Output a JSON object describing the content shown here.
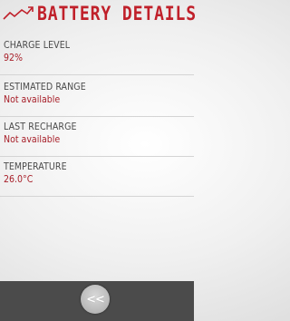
{
  "header": {
    "title": "BATTERY DETAILS",
    "logo_icon": "trend-line-icon",
    "accent_color": "#c0202a"
  },
  "details": [
    {
      "label": "CHARGE LEVEL",
      "value": "92%"
    },
    {
      "label": "ESTIMATED RANGE",
      "value": "Not available"
    },
    {
      "label": "LAST RECHARGE",
      "value": "Not available"
    },
    {
      "label": "TEMPERATURE",
      "value": "26.0°C"
    }
  ],
  "footer": {
    "back_label": "<<",
    "back_icon": "double-chevron-left-icon"
  }
}
